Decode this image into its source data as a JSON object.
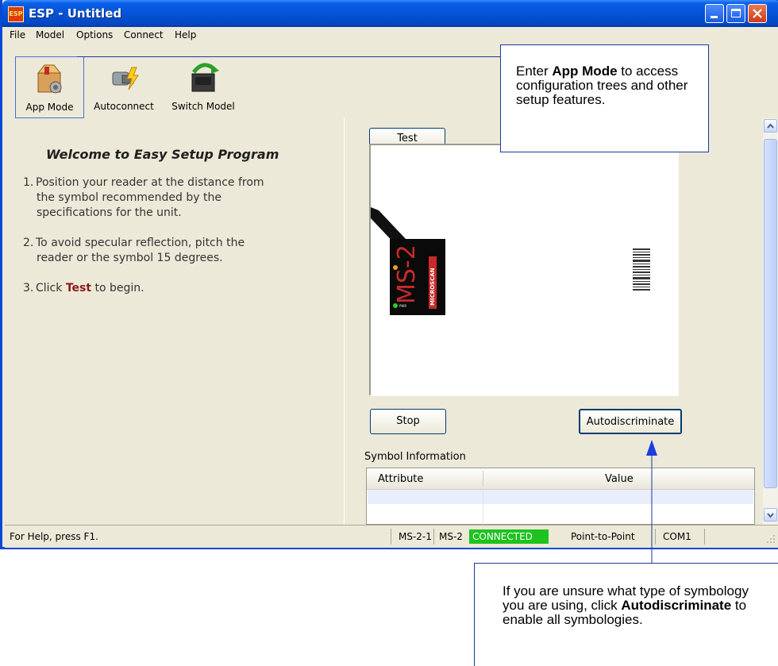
{
  "window": {
    "icon_text": "ESP",
    "title": "ESP - Untitled"
  },
  "menu": [
    "File",
    "Model",
    "Options",
    "Connect",
    "Help"
  ],
  "toolbar": {
    "app_mode": "App Mode",
    "autoconnect": "Autoconnect",
    "switch_model": "Switch Model"
  },
  "welcome": {
    "title": "Welcome to Easy Setup Program",
    "step1_num": "1.",
    "step1_a": "Position your reader at the distance from",
    "step1_b": "the symbol recommended by the",
    "step1_c": "specifications for the unit.",
    "step2_num": "2.",
    "step2_a": "To avoid specular reflection, pitch the",
    "step2_b": "reader or the symbol 15 degrees.",
    "step3_num": "3.",
    "step3_pre": "Click",
    "step3_hl": "Test",
    "step3_post": "to begin."
  },
  "right": {
    "test_button": "Test",
    "stop_button": "Stop",
    "autodiscriminate_button": "Autodiscriminate",
    "symbol_info_label": "Symbol Information",
    "col_attribute": "Attribute",
    "col_value": "Value",
    "device_model_text": "MS-2",
    "device_brand_text": "MICROSCAN",
    "device_pwr_text": "PWR"
  },
  "status": {
    "help": "For Help, press F1.",
    "model1": "MS-2-1",
    "model2": "MS-2",
    "connection": "CONNECTED",
    "mode": "Point-to-Point",
    "port": "COM1"
  },
  "callouts": {
    "app_mode_pre": "Enter",
    "app_mode_bold": "App Mode",
    "app_mode_post": "to access configuration trees and other setup features.",
    "auto_pre": "If you are unsure what type of symbology you are using, click",
    "auto_bold": "Autodiscriminate",
    "auto_post": "to enable all symbologies."
  },
  "colors": {
    "titlebar": "#0553d6",
    "connected": "#1ec31e",
    "callout_border": "#1a3a9a",
    "highlight_text": "#8b1a1a"
  }
}
